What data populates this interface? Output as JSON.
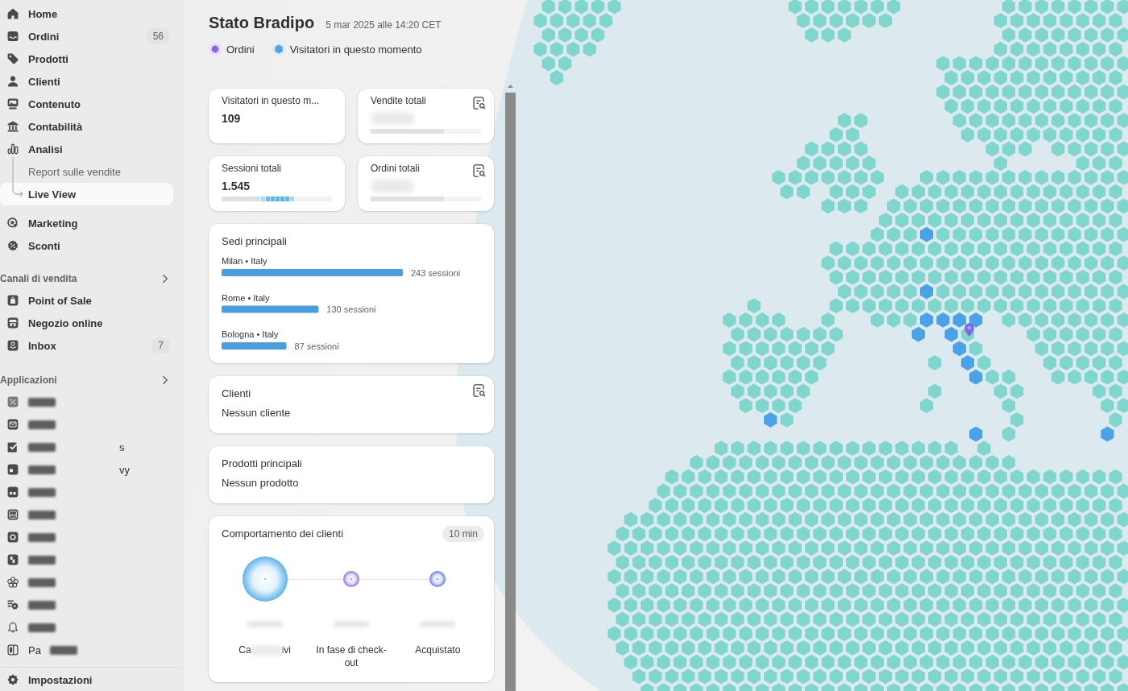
{
  "sidebar": {
    "nav": [
      {
        "label": "Home",
        "selected": false
      },
      {
        "label": "Ordini",
        "badge": "56",
        "selected": false
      },
      {
        "label": "Prodotti",
        "selected": false
      },
      {
        "label": "Clienti",
        "selected": false
      },
      {
        "label": "Contenuto",
        "selected": false
      },
      {
        "label": "Contabilità",
        "selected": false
      },
      {
        "label": "Analisi",
        "selected": false,
        "expanded": true,
        "children": [
          {
            "label": "Report sulle vendite",
            "selected": false
          },
          {
            "label": "Live View",
            "selected": true
          }
        ]
      },
      {
        "label": "Marketing",
        "selected": false
      },
      {
        "label": "Sconti",
        "selected": false
      }
    ],
    "sales_channels": {
      "title": "Canali di vendita",
      "items": [
        {
          "label": "Point of Sale",
          "selected": false
        },
        {
          "label": "Negozio online",
          "selected": false
        },
        {
          "label": "Inbox",
          "badge": "7",
          "selected": false
        }
      ]
    },
    "apps": {
      "title": "Applicazioni",
      "items": [
        {
          "redacted": true,
          "selected": false
        },
        {
          "redacted": true,
          "selected": false
        },
        {
          "redacted": true,
          "label_end": "s",
          "selected": false
        },
        {
          "redacted": true,
          "label_end": "vy",
          "selected": false
        },
        {
          "redacted": true,
          "selected": false
        },
        {
          "redacted": true,
          "selected": false
        },
        {
          "redacted": true,
          "selected": false
        },
        {
          "redacted": true,
          "selected": false
        },
        {
          "redacted": true,
          "selected": false
        },
        {
          "redacted": true,
          "selected": false
        },
        {
          "redacted": true,
          "selected": false
        },
        {
          "redacted": true,
          "label_start": "Pa",
          "selected": false
        }
      ]
    },
    "settings": {
      "label": "Impostazioni",
      "selected": false
    }
  },
  "header": {
    "title": "Stato Bradipo",
    "timestamp": "5 mar 2025 alle 14:20 CET",
    "legend": [
      {
        "label": "Ordini",
        "kind": "dot",
        "color": "#8b64ec"
      },
      {
        "label": "Visitatori in questo momento",
        "kind": "hex",
        "color": "#4aa3e6"
      }
    ]
  },
  "metrics": [
    {
      "kind": "count",
      "title": "Visitatori in questo m...",
      "value": "109"
    },
    {
      "kind": "report",
      "title": "Vendite totali",
      "value_redacted": true
    },
    {
      "kind": "sessions",
      "title": "Sessioni totali",
      "value": "1.545"
    },
    {
      "kind": "report",
      "title": "Ordini totali",
      "value_redacted": true
    }
  ],
  "top_locations": {
    "title": "Sedi principali",
    "chart_data": {
      "type": "bar",
      "orientation": "horizontal",
      "categories": [
        "Milan • Italy",
        "Rome • Italy",
        "Bologna • Italy"
      ],
      "values": [
        243,
        130,
        87
      ],
      "value_labels": [
        "243 sessioni",
        "130 sessioni",
        "87 sessioni"
      ]
    }
  },
  "customers": {
    "title": "Clienti",
    "empty_text": "Nessun cliente"
  },
  "top_products": {
    "title": "Prodotti principali",
    "empty_text": "Nessun prodotto"
  },
  "behavior": {
    "title": "Comportamento dei clienti",
    "period": "10 min",
    "stages": [
      {
        "label_start": "Ca",
        "label_end": "ivi",
        "label_redacted": true,
        "value_redacted": true
      },
      {
        "label": "In fase di check-out",
        "value_redacted": true
      },
      {
        "label": "Acquistato",
        "value_redacted": true
      }
    ]
  }
}
